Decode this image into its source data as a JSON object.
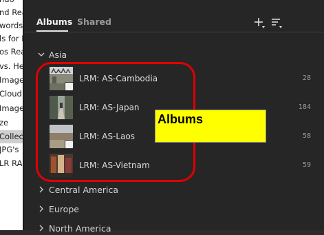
{
  "colors": {
    "panel_bg": "#262626",
    "annotation_red": "#e00000",
    "annotation_yellow": "#ffff00"
  },
  "left_list": [
    {
      "text": "ndo",
      "selected": false
    },
    {
      "text": "nd Rea",
      "selected": false
    },
    {
      "text": "words",
      "selected": false
    },
    {
      "text": "ls for P",
      "selected": false
    },
    {
      "text": "os Rea",
      "selected": false
    },
    {
      "text": "vs. He",
      "selected": false
    },
    {
      "text": "Image",
      "selected": false
    },
    {
      "text": "Cloud",
      "selected": false
    },
    {
      "text": "Image",
      "selected": false
    },
    {
      "text": "ze",
      "selected": false
    },
    {
      "text": "Collec",
      "selected": true
    },
    {
      "text": "JPG's",
      "selected": false
    },
    {
      "text": "LR RA",
      "selected": false
    }
  ],
  "tabs": {
    "albums": "Albums",
    "shared": "Shared"
  },
  "toolbar": {
    "add_icon": "plus-icon",
    "sort_icon": "sort-icon"
  },
  "sections": {
    "asia": "Asia",
    "central_america": "Central America",
    "europe": "Europe",
    "north_america": "North America"
  },
  "albums": [
    {
      "name": "LRM: AS-Cambodia",
      "count": "28",
      "badge": true
    },
    {
      "name": "LRM: AS-Japan",
      "count": "184",
      "badge": false
    },
    {
      "name": "LRM: AS-Laos",
      "count": "58",
      "badge": true
    },
    {
      "name": "LRM: AS-Vietnam",
      "count": "59",
      "badge": false
    }
  ],
  "annotation": {
    "label": "Albums"
  }
}
